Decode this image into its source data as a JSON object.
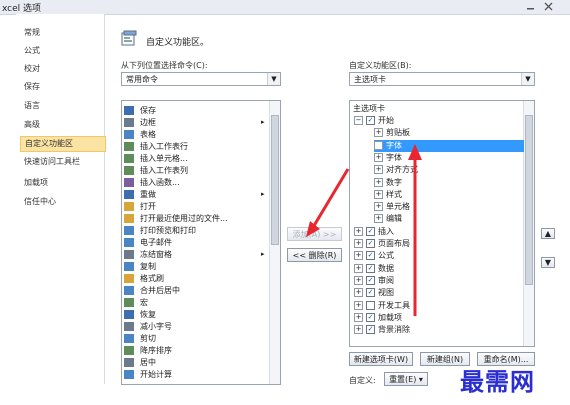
{
  "window": {
    "title": "xcel 选项"
  },
  "sidebar": {
    "items": [
      {
        "label": "常规"
      },
      {
        "label": "公式"
      },
      {
        "label": "校对"
      },
      {
        "label": "保存"
      },
      {
        "label": "语言"
      },
      {
        "label": "高级"
      },
      {
        "label": "自定义功能区"
      },
      {
        "label": "快速访问工具栏"
      },
      {
        "label": "加载项"
      },
      {
        "label": "信任中心"
      }
    ],
    "selected": 6
  },
  "main": {
    "heading": "自定义功能区。",
    "left_label": "从下列位置选择命令(C):",
    "left_combo": "常用命令",
    "right_label": "自定义功能区(B):",
    "right_combo": "主选项卡",
    "commands": [
      {
        "label": "保存",
        "icon": "save-icon"
      },
      {
        "label": "边框",
        "icon": "border-icon",
        "sub": "▸"
      },
      {
        "label": "表格",
        "icon": "table-icon"
      },
      {
        "label": "插入工作表行",
        "icon": "insert-row-icon"
      },
      {
        "label": "插入单元格...",
        "icon": "insert-cell-icon"
      },
      {
        "label": "插入工作表列",
        "icon": "insert-column-icon"
      },
      {
        "label": "插入函数...",
        "icon": "function-icon"
      },
      {
        "label": "重做",
        "icon": "redo-icon",
        "sub": "▸"
      },
      {
        "label": "打开",
        "icon": "open-icon"
      },
      {
        "label": "打开最近使用过的文件...",
        "icon": "recent-file-icon"
      },
      {
        "label": "打印预览和打印",
        "icon": "print-preview-icon"
      },
      {
        "label": "电子邮件",
        "icon": "email-icon"
      },
      {
        "label": "冻结窗格",
        "icon": "freeze-panes-icon",
        "sub": "▸"
      },
      {
        "label": "复制",
        "icon": "copy-icon"
      },
      {
        "label": "格式刷",
        "icon": "format-painter-icon"
      },
      {
        "label": "合并后居中",
        "icon": "merge-center-icon"
      },
      {
        "label": "宏",
        "icon": "macro-icon"
      },
      {
        "label": "恢复",
        "icon": "restore-icon"
      },
      {
        "label": "减小字号",
        "icon": "decrease-font-icon"
      },
      {
        "label": "剪切",
        "icon": "cut-icon"
      },
      {
        "label": "降序排序",
        "icon": "sort-desc-icon"
      },
      {
        "label": "居中",
        "icon": "center-icon"
      },
      {
        "label": "开始计算",
        "icon": "calculate-icon"
      }
    ],
    "add_button": "添加(A) >>",
    "remove_button": "<< 删除(R)",
    "tree": {
      "header": "主选项卡",
      "items": [
        {
          "label": "开始",
          "level": 0,
          "expander": "−",
          "checked": true
        },
        {
          "label": "剪贴板",
          "level": 1,
          "expander": "+"
        },
        {
          "label": "字体",
          "level": 1,
          "expander": "+",
          "selected": true
        },
        {
          "label": "字体",
          "level": 1,
          "expander": "+"
        },
        {
          "label": "对齐方式",
          "level": 1,
          "expander": "+"
        },
        {
          "label": "数字",
          "level": 1,
          "expander": "+"
        },
        {
          "label": "样式",
          "level": 1,
          "expander": "+"
        },
        {
          "label": "单元格",
          "level": 1,
          "expander": "+"
        },
        {
          "label": "编辑",
          "level": 1,
          "expander": "+"
        },
        {
          "label": "插入",
          "level": 0,
          "expander": "+",
          "checked": true
        },
        {
          "label": "页面布局",
          "level": 0,
          "expander": "+",
          "checked": true
        },
        {
          "label": "公式",
          "level": 0,
          "expander": "+",
          "checked": true
        },
        {
          "label": "数据",
          "level": 0,
          "expander": "+",
          "checked": true
        },
        {
          "label": "审阅",
          "level": 0,
          "expander": "+",
          "checked": true
        },
        {
          "label": "视图",
          "level": 0,
          "expander": "+",
          "checked": true
        },
        {
          "label": "开发工具",
          "level": 0,
          "expander": "+",
          "checked": false
        },
        {
          "label": "加载项",
          "level": 0,
          "expander": "+",
          "checked": true
        },
        {
          "label": "背景消除",
          "level": 0,
          "expander": "+",
          "checked": true
        }
      ]
    },
    "new_tab_button": "新建选项卡(W)",
    "new_group_button": "新建组(N)",
    "rename_button": "重命名(M)...",
    "customize_label": "自定义:",
    "reset_button": "重置(E) ▾"
  },
  "watermark": "最需网",
  "colors": {
    "selection": "#3399ff",
    "sidebar_selected": "#fbe3a2",
    "arrow": "#e8262f",
    "watermark": "#2a2ed0"
  }
}
